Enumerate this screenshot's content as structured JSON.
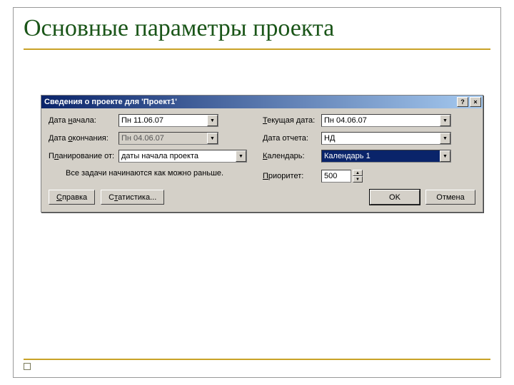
{
  "slide": {
    "title": "Основные параметры проекта"
  },
  "dialog": {
    "title": "Сведения о проекте для 'Проект1'",
    "help": "?",
    "close": "×",
    "labels": {
      "start_date": "Дата начала:",
      "end_date": "Дата окончания:",
      "plan_from": "Планирование от:",
      "current_date": "Текущая дата:",
      "report_date": "Дата отчета:",
      "calendar": "Календарь:",
      "priority": "Приоритет:"
    },
    "values": {
      "start_date": "Пн 11.06.07",
      "end_date": "Пн 04.06.07",
      "plan_from": "даты начала проекта",
      "current_date": "Пн 04.06.07",
      "report_date": "НД",
      "calendar": "Календарь 1",
      "priority": "500"
    },
    "hint": "Все задачи начинаются как можно раньше.",
    "buttons": {
      "help": "Справка",
      "stats": "Статистика...",
      "ok": "OK",
      "cancel": "Отмена"
    }
  }
}
